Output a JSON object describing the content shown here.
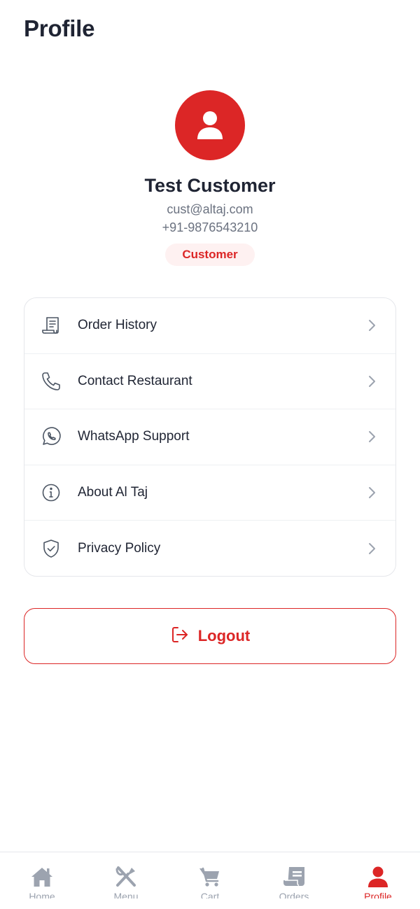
{
  "header": {
    "title": "Profile"
  },
  "profile": {
    "name": "Test Customer",
    "email": "cust@altaj.com",
    "phone": "+91-9876543210",
    "role": "Customer",
    "avatar_icon": "user-icon"
  },
  "menu": {
    "items": [
      {
        "label": "Order History",
        "icon": "receipt-icon"
      },
      {
        "label": "Contact Restaurant",
        "icon": "phone-icon"
      },
      {
        "label": "WhatsApp Support",
        "icon": "whatsapp-icon"
      },
      {
        "label": "About Al Taj",
        "icon": "info-icon"
      },
      {
        "label": "Privacy Policy",
        "icon": "shield-check-icon"
      }
    ]
  },
  "logout": {
    "label": "Logout",
    "icon": "logout-icon"
  },
  "bottom_nav": {
    "items": [
      {
        "label": "Home",
        "icon": "home-icon"
      },
      {
        "label": "Menu",
        "icon": "utensils-icon"
      },
      {
        "label": "Cart",
        "icon": "cart-icon"
      },
      {
        "label": "Orders",
        "icon": "orders-icon"
      },
      {
        "label": "Profile",
        "icon": "user-icon",
        "active": true
      }
    ]
  },
  "colors": {
    "accent": "#dc2626",
    "text": "#1f2433",
    "muted": "#6b7280",
    "nav_inactive": "#9ca3af",
    "badge_bg": "#fef1f1"
  }
}
